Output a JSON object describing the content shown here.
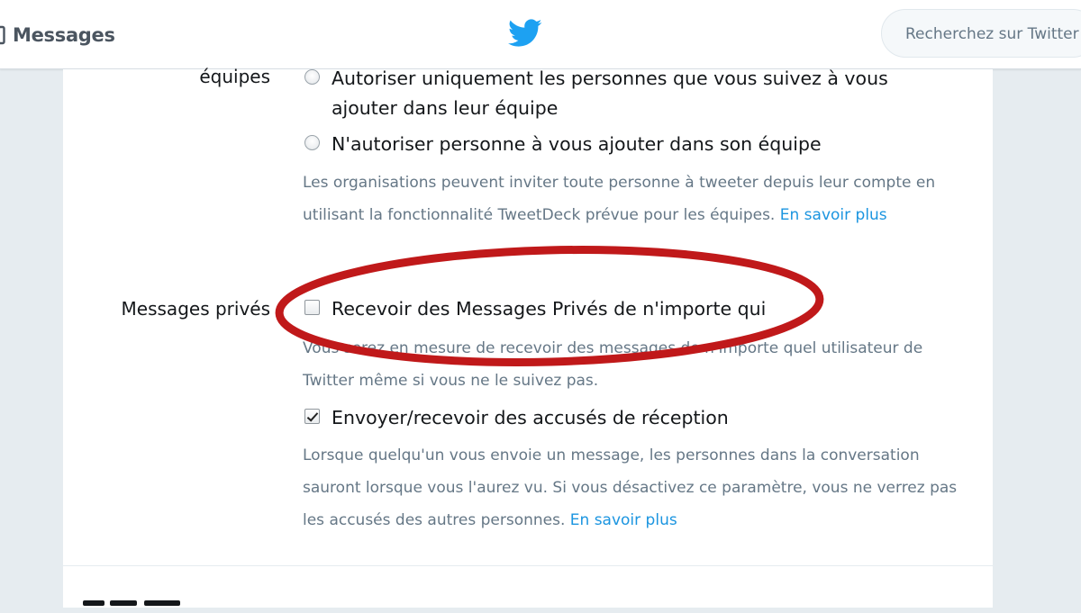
{
  "header": {
    "messages_label": "Messages",
    "search_placeholder": "Recherchez sur Twitter",
    "brand_color": "#1da1f2"
  },
  "teams": {
    "label": "équipes",
    "option_followers": "Autoriser uniquement les personnes que vous suivez à vous ajouter dans leur équipe",
    "option_nobody": "N'autoriser personne à vous ajouter dans son équipe",
    "help": "Les organisations peuvent inviter toute personne à tweeter depuis leur compte en utilisant la fonctionnalité TweetDeck prévue pour les équipes.",
    "learn_more": "En savoir plus"
  },
  "direct_messages": {
    "label": "Messages privés",
    "receive_from_anyone": {
      "label": "Recevoir des Messages Privés de n'importe qui",
      "checked": false,
      "help": "Vous serez en mesure de recevoir des messages de n'importe quel utilisateur de Twitter même si vous ne le suivez pas."
    },
    "read_receipts": {
      "label": "Envoyer/recevoir des accusés de réception",
      "checked": true,
      "help": "Lorsque quelqu'un vous envoie un message, les personnes dans la conversation sauront lorsque vous l'aurez vu. Si vous désactivez ce paramètre, vous ne verrez pas les accusés des autres personnes.",
      "learn_more": "En savoir plus"
    }
  },
  "annotation": {
    "color": "#c0191a"
  },
  "icons": [
    "mail-icon",
    "twitter-bird-icon"
  ],
  "link_color": "#1b95e0"
}
